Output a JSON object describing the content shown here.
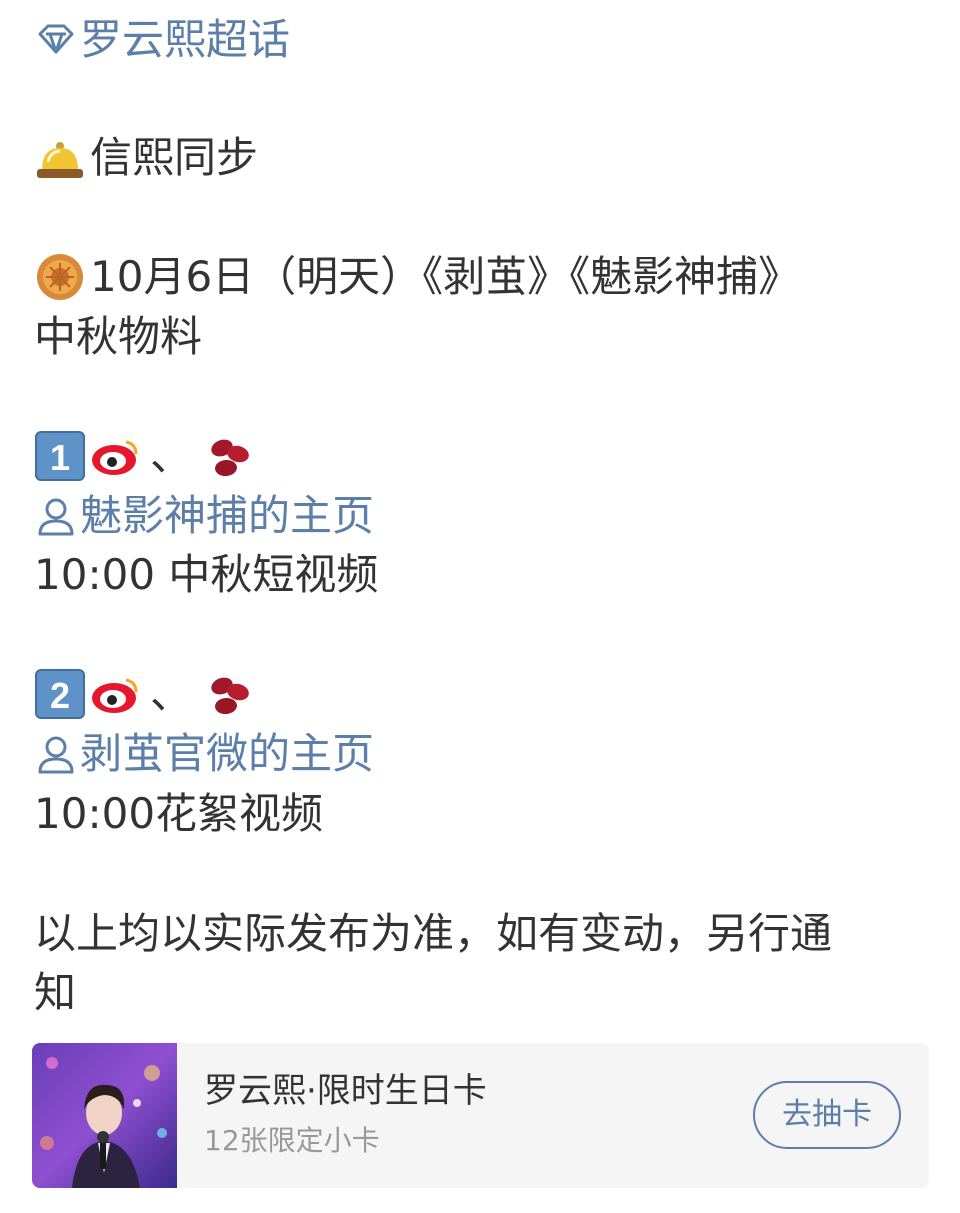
{
  "topic": {
    "label": "罗云熙超话",
    "icon": "diamond-icon"
  },
  "heading": {
    "text": "信熙同步",
    "icon": "bell-icon"
  },
  "notice": {
    "icon": "mooncake-icon",
    "line1": "10月6日（明天）《剥茧》《魅影神捕》",
    "line2": "中秋物料"
  },
  "items": [
    {
      "number_icon": "keycap-1-icon",
      "sep": "、",
      "user_link": "魅影神捕的主页",
      "detail": "10:00 中秋短视频"
    },
    {
      "number_icon": "keycap-2-icon",
      "sep": "、",
      "user_link": "剥茧官微的主页",
      "detail": "10:00花絮视频"
    }
  ],
  "footer": {
    "line1": "以上均以实际发布为准，如有变动，另行通",
    "line2": "知"
  },
  "card": {
    "title": "罗云熙·限时生日卡",
    "subtitle": "12张限定小卡",
    "button": "去抽卡"
  },
  "colors": {
    "link": "#5b7fa9",
    "text": "#333333",
    "card_bg": "#f5f5f5",
    "weibo_red": "#e6162d"
  }
}
